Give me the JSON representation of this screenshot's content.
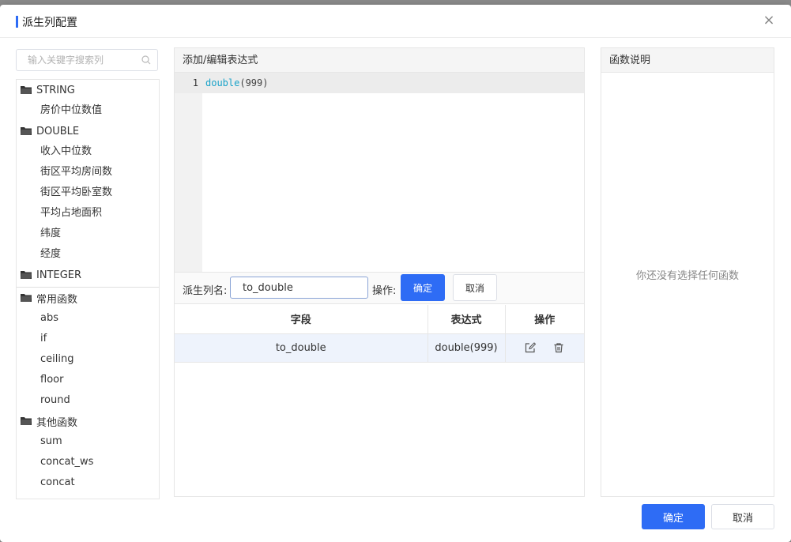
{
  "dialog": {
    "title": "派生列配置",
    "close_label": "×"
  },
  "search": {
    "placeholder": "输入关键字搜索列"
  },
  "tree": {
    "groups": [
      {
        "label": "STRING",
        "items": [
          "房价中位数值"
        ]
      },
      {
        "label": "DOUBLE",
        "items": [
          "收入中位数",
          "街区平均房间数",
          "街区平均卧室数",
          "平均占地面积",
          "纬度",
          "经度"
        ]
      },
      {
        "label": "INTEGER",
        "items": []
      }
    ],
    "function_groups": [
      {
        "label": "常用函数",
        "items": [
          "abs",
          "if",
          "ceiling",
          "floor",
          "round"
        ]
      },
      {
        "label": "其他函数",
        "items": [
          "sum",
          "concat_ws",
          "concat"
        ]
      }
    ]
  },
  "editor": {
    "header": "添加/编辑表达式",
    "line_number": "1",
    "code_fn": "double",
    "code_args": "(999)"
  },
  "name_row": {
    "label": "派生列名:",
    "value": "to_double",
    "op_label": "操作:",
    "confirm": "确定",
    "cancel": "取消"
  },
  "table": {
    "columns": [
      "字段",
      "表达式",
      "操作"
    ],
    "rows": [
      {
        "field": "to_double",
        "expression": "double(999)"
      }
    ]
  },
  "help": {
    "header": "函数说明",
    "empty_text": "你还没有选择任何函数"
  },
  "footer": {
    "ok": "确定",
    "cancel": "取消"
  },
  "colors": {
    "accent": "#2e6cf5",
    "row_highlight": "#eef3fc",
    "code_function": "#1aa3c9"
  },
  "icons": {
    "search": "search-icon",
    "folder": "folder-icon",
    "edit": "edit-icon",
    "delete": "trash-icon",
    "close": "close-icon"
  }
}
